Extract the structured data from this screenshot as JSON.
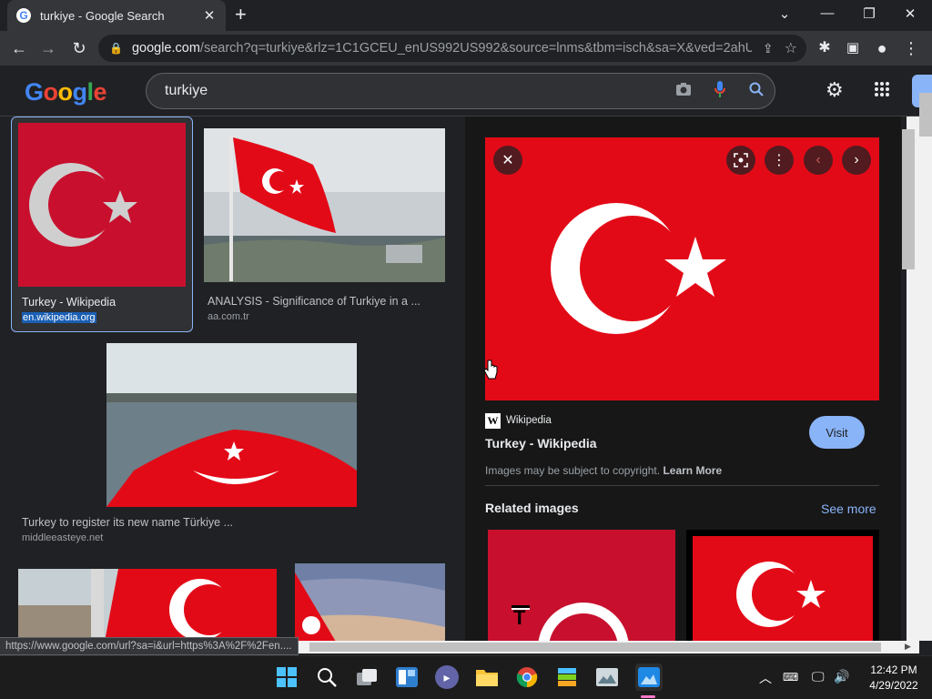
{
  "browser": {
    "tab_title": "turkiye - Google Search",
    "url_host": "google.com",
    "url_rest": "/search?q=turkiye&rlz=1C1GCEU_enUS992US992&source=lnms&tbm=isch&sa=X&ved=2ahU..."
  },
  "google": {
    "logo": "Google",
    "query": "turkiye"
  },
  "results": [
    {
      "title": "Turkey - Wikipedia",
      "source": "en.wikipedia.org"
    },
    {
      "title": "ANALYSIS - Significance of Turkiye in a ...",
      "source": "aa.com.tr"
    },
    {
      "title": "Turkey to register its new name Türkiye ...",
      "source": "middleeasteye.net"
    }
  ],
  "preview": {
    "site": "Wikipedia",
    "title": "Turkey - Wikipedia",
    "visit": "Visit",
    "copyright": "Images may be subject to copyright.",
    "learn_more": "Learn More",
    "related": "Related images",
    "see_more": "See more"
  },
  "status_url": "https://www.google.com/url?sa=i&url=https%3A%2F%2Fen....",
  "taskbar": {
    "time": "12:42 PM",
    "date": "4/29/2022"
  },
  "colors": {
    "flag_red": "#e30a17",
    "accent_blue": "#8ab4f8"
  }
}
